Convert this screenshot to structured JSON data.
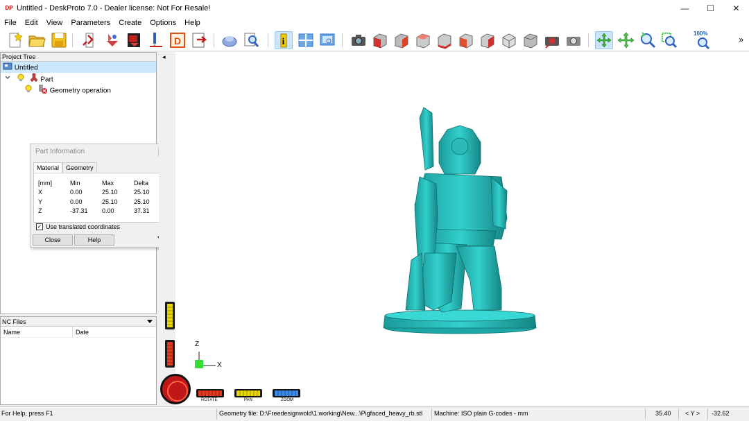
{
  "window": {
    "app_icon": "DP",
    "title": "Untitled - DeskProto 7.0 - Dealer license: Not For Resale!",
    "minimize": "—",
    "maximize": "☐",
    "close": "✕"
  },
  "menu": [
    "File",
    "Edit",
    "View",
    "Parameters",
    "Create",
    "Options",
    "Help"
  ],
  "toolbar": {
    "zoom100_label": "100%",
    "more_label": "»",
    "buttons": [
      "new-file-icon",
      "open-folder-icon",
      "save-icon",
      "import-geometry-icon",
      "import-vector-icon",
      "import-bitmap-icon",
      "machining-icon",
      "create-d-icon",
      "export-icon",
      "material-shape-icon",
      "inspect-icon",
      "part-info-icon",
      "layout-views-icon",
      "show-screen-icon",
      "camera-view-icon",
      "view-front-icon",
      "view-back-icon",
      "view-left-icon",
      "view-right-icon",
      "view-top-icon",
      "view-bottom-icon",
      "view-iso1-icon",
      "view-iso2-icon",
      "render-icon",
      "render2-icon",
      "rotate-icon",
      "pan-icon",
      "zoom-icon",
      "zoom-window-icon",
      "zoom-100-icon"
    ]
  },
  "project_tree": {
    "header": "Project Tree",
    "items": [
      {
        "label": "Untitled",
        "level": 0
      },
      {
        "label": "Part",
        "level": 1
      },
      {
        "label": "Geometry operation",
        "level": 2
      }
    ]
  },
  "part_info": {
    "title": "Part Information",
    "tabs": [
      "Material",
      "Geometry"
    ],
    "active_tab": "Material",
    "columns": [
      "[mm]",
      "Min",
      "Max",
      "Delta"
    ],
    "rows": [
      [
        "X",
        "0.00",
        "25.10",
        "25.10"
      ],
      [
        "Y",
        "0.00",
        "25.10",
        "25.10"
      ],
      [
        "Z",
        "-37.31",
        "0.00",
        "37.31"
      ]
    ],
    "checkbox_label": "Use translated coordinates",
    "checkbox_checked": true,
    "close_button": "Close",
    "help_button": "Help"
  },
  "nc_files": {
    "header": "NC Files",
    "columns": [
      "Name",
      "Date"
    ]
  },
  "viewport": {
    "axis_z": "Z",
    "axis_x": "X",
    "controls": [
      "ROTATE",
      "PAN",
      "ZOOM"
    ],
    "model_color": "#2ec4c4",
    "collapse_arrow": "◂"
  },
  "status": {
    "help": "For Help, press F1",
    "geometry_file": "Geometry file: D:\\Freedesignwold\\1.working\\New...\\Pigfaced_heavy_rb.stl",
    "machine": "Machine: ISO plain G-codes - mm",
    "coord_value": "35.40",
    "coord_axis": "< Y >",
    "coord_value2": "-32.62"
  }
}
